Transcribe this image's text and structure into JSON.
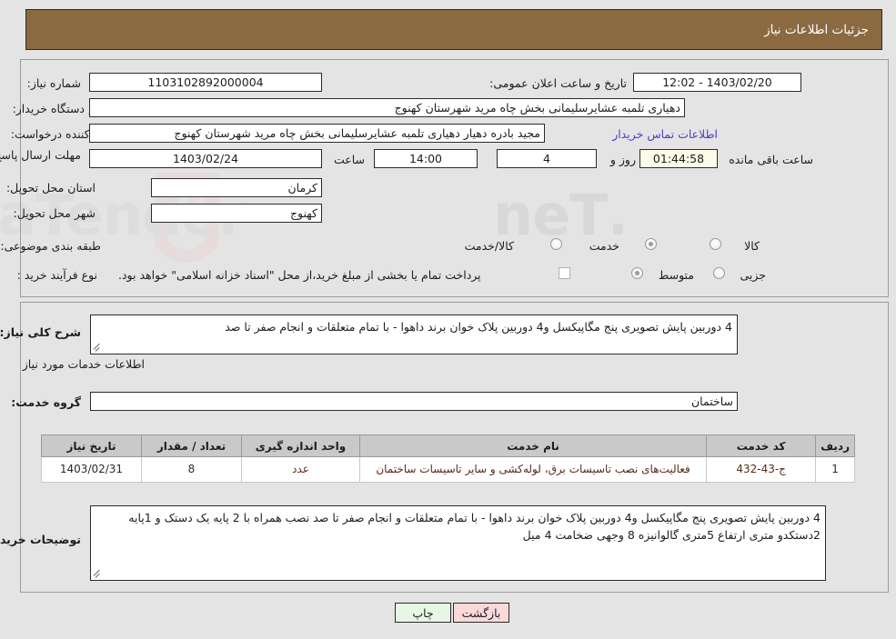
{
  "header": {
    "title": "جزئیات اطلاعات نیاز"
  },
  "form": {
    "need_number_label": "شماره نیاز:",
    "need_number_value": "1103102892000004",
    "public_announce_label": "تاریخ و ساعت اعلان عمومی:",
    "public_announce_value": "1403/02/20 - 12:02",
    "buyer_org_label": "نام دستگاه خریدار:",
    "buyer_org_value": "دهیاری تلمبه عشایرسلیمانی بخش چاه مرید شهرستان کهنوج",
    "requester_label": "ایجاد کننده درخواست:",
    "requester_value": "مجید بادره دهیار دهیاری تلمبه عشایرسلیمانی بخش چاه مرید شهرستان کهنوج",
    "contact_link": "اطلاعات تماس خریدار",
    "deadline_label": "مهلت ارسال پاسخ: تا تاریخ:",
    "deadline_date": "1403/02/24",
    "hour_label": "ساعت",
    "hour_value": "14:00",
    "days_value": "4",
    "days_unit_label": "روز و",
    "countdown_value": "01:44:58",
    "countdown_unit_label": "ساعت باقی مانده",
    "province_label": "استان محل تحویل:",
    "province_value": "کرمان",
    "city_label": "شهر محل تحویل:",
    "city_value": "کهنوج",
    "category_label": "طبقه بندی موضوعی:",
    "category_options": [
      {
        "label": "کالا",
        "selected": false
      },
      {
        "label": "خدمت",
        "selected": true
      },
      {
        "label": "کالا/خدمت",
        "selected": false
      }
    ],
    "process_label": "نوع فرآیند خرید :",
    "process_options": [
      {
        "label": "جزیی",
        "selected": false
      },
      {
        "label": "متوسط",
        "selected": true
      }
    ],
    "treasury_checkbox_checked": false,
    "treasury_note": "پرداخت تمام یا بخشی از مبلغ خرید،از محل \"اسناد خزانه اسلامی\" خواهد بود."
  },
  "description": {
    "label": "شرح کلی نیاز:",
    "value": "4 دوربین پایش تصویری پنج مگاپیکسل و4 دوربین پلاک خوان برند داهوا - با تمام متعلقات و انجام صفر تا صد"
  },
  "services_section": {
    "heading": "اطلاعات خدمات مورد نیاز",
    "group_label": "گروه خدمت:",
    "group_value": "ساختمان"
  },
  "table": {
    "columns": [
      "ردیف",
      "کد خدمت",
      "نام خدمت",
      "واحد اندازه گیری",
      "تعداد / مقدار",
      "تاریخ نیاز"
    ],
    "rows": [
      {
        "row_no": "1",
        "service_code": "ج-43-432",
        "service_name": "فعالیت‌های نصب تاسیسات برق، لوله‌کشی و سایر تاسیسات ساختمان",
        "unit": "عدد",
        "quantity": "8",
        "need_date": "1403/02/31"
      }
    ]
  },
  "buyer_notes": {
    "label": "توضیحات خریدار:",
    "value": "4 دوربین پایش تصویری پنج مگاپیکسل و4 دوربین پلاک خوان برند داهوا - با تمام متعلقات و انجام صفر تا صد نصب همراه با 2 پایه یک دستک و 1پایه 2دستکدو متری ارتفاع  5متری گالوانیزه 8 وجهی ضخامت 4 میل"
  },
  "actions": {
    "print_label": "چاپ",
    "back_label": "بازگشت"
  },
  "colors": {
    "header_bg": "#8b6a42",
    "page_bg": "#e4e4e4",
    "link": "#4b3fc4",
    "table_header_bg": "#c9c9c9",
    "print_btn_bg": "#e6f7e6",
    "back_btn_bg": "#fbd9d9",
    "countdown_bg": "#fbfbe7"
  }
}
